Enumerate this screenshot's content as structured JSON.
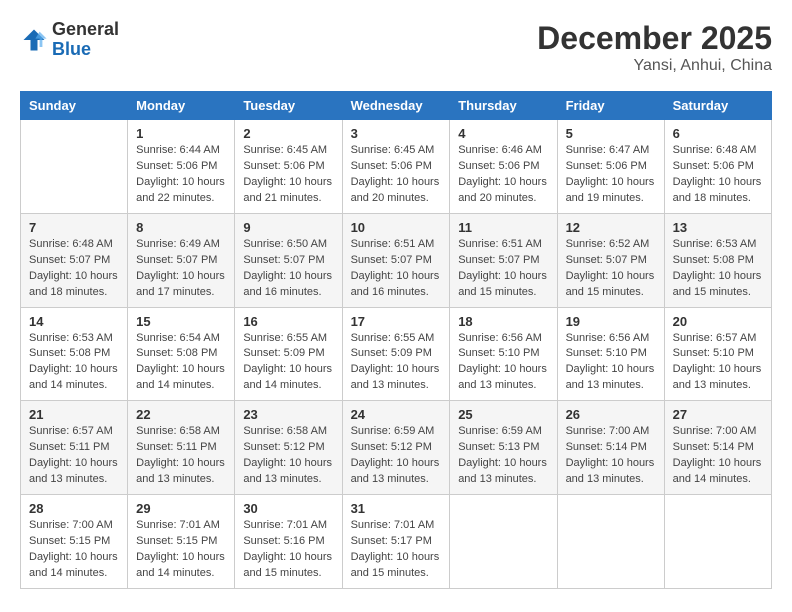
{
  "header": {
    "logo_general": "General",
    "logo_blue": "Blue",
    "month_title": "December 2025",
    "location": "Yansi, Anhui, China"
  },
  "weekdays": [
    "Sunday",
    "Monday",
    "Tuesday",
    "Wednesday",
    "Thursday",
    "Friday",
    "Saturday"
  ],
  "weeks": [
    [
      {
        "day": "",
        "info": ""
      },
      {
        "day": "1",
        "info": "Sunrise: 6:44 AM\nSunset: 5:06 PM\nDaylight: 10 hours\nand 22 minutes."
      },
      {
        "day": "2",
        "info": "Sunrise: 6:45 AM\nSunset: 5:06 PM\nDaylight: 10 hours\nand 21 minutes."
      },
      {
        "day": "3",
        "info": "Sunrise: 6:45 AM\nSunset: 5:06 PM\nDaylight: 10 hours\nand 20 minutes."
      },
      {
        "day": "4",
        "info": "Sunrise: 6:46 AM\nSunset: 5:06 PM\nDaylight: 10 hours\nand 20 minutes."
      },
      {
        "day": "5",
        "info": "Sunrise: 6:47 AM\nSunset: 5:06 PM\nDaylight: 10 hours\nand 19 minutes."
      },
      {
        "day": "6",
        "info": "Sunrise: 6:48 AM\nSunset: 5:06 PM\nDaylight: 10 hours\nand 18 minutes."
      }
    ],
    [
      {
        "day": "7",
        "info": "Sunrise: 6:48 AM\nSunset: 5:07 PM\nDaylight: 10 hours\nand 18 minutes."
      },
      {
        "day": "8",
        "info": "Sunrise: 6:49 AM\nSunset: 5:07 PM\nDaylight: 10 hours\nand 17 minutes."
      },
      {
        "day": "9",
        "info": "Sunrise: 6:50 AM\nSunset: 5:07 PM\nDaylight: 10 hours\nand 16 minutes."
      },
      {
        "day": "10",
        "info": "Sunrise: 6:51 AM\nSunset: 5:07 PM\nDaylight: 10 hours\nand 16 minutes."
      },
      {
        "day": "11",
        "info": "Sunrise: 6:51 AM\nSunset: 5:07 PM\nDaylight: 10 hours\nand 15 minutes."
      },
      {
        "day": "12",
        "info": "Sunrise: 6:52 AM\nSunset: 5:07 PM\nDaylight: 10 hours\nand 15 minutes."
      },
      {
        "day": "13",
        "info": "Sunrise: 6:53 AM\nSunset: 5:08 PM\nDaylight: 10 hours\nand 15 minutes."
      }
    ],
    [
      {
        "day": "14",
        "info": "Sunrise: 6:53 AM\nSunset: 5:08 PM\nDaylight: 10 hours\nand 14 minutes."
      },
      {
        "day": "15",
        "info": "Sunrise: 6:54 AM\nSunset: 5:08 PM\nDaylight: 10 hours\nand 14 minutes."
      },
      {
        "day": "16",
        "info": "Sunrise: 6:55 AM\nSunset: 5:09 PM\nDaylight: 10 hours\nand 14 minutes."
      },
      {
        "day": "17",
        "info": "Sunrise: 6:55 AM\nSunset: 5:09 PM\nDaylight: 10 hours\nand 13 minutes."
      },
      {
        "day": "18",
        "info": "Sunrise: 6:56 AM\nSunset: 5:10 PM\nDaylight: 10 hours\nand 13 minutes."
      },
      {
        "day": "19",
        "info": "Sunrise: 6:56 AM\nSunset: 5:10 PM\nDaylight: 10 hours\nand 13 minutes."
      },
      {
        "day": "20",
        "info": "Sunrise: 6:57 AM\nSunset: 5:10 PM\nDaylight: 10 hours\nand 13 minutes."
      }
    ],
    [
      {
        "day": "21",
        "info": "Sunrise: 6:57 AM\nSunset: 5:11 PM\nDaylight: 10 hours\nand 13 minutes."
      },
      {
        "day": "22",
        "info": "Sunrise: 6:58 AM\nSunset: 5:11 PM\nDaylight: 10 hours\nand 13 minutes."
      },
      {
        "day": "23",
        "info": "Sunrise: 6:58 AM\nSunset: 5:12 PM\nDaylight: 10 hours\nand 13 minutes."
      },
      {
        "day": "24",
        "info": "Sunrise: 6:59 AM\nSunset: 5:12 PM\nDaylight: 10 hours\nand 13 minutes."
      },
      {
        "day": "25",
        "info": "Sunrise: 6:59 AM\nSunset: 5:13 PM\nDaylight: 10 hours\nand 13 minutes."
      },
      {
        "day": "26",
        "info": "Sunrise: 7:00 AM\nSunset: 5:14 PM\nDaylight: 10 hours\nand 13 minutes."
      },
      {
        "day": "27",
        "info": "Sunrise: 7:00 AM\nSunset: 5:14 PM\nDaylight: 10 hours\nand 14 minutes."
      }
    ],
    [
      {
        "day": "28",
        "info": "Sunrise: 7:00 AM\nSunset: 5:15 PM\nDaylight: 10 hours\nand 14 minutes."
      },
      {
        "day": "29",
        "info": "Sunrise: 7:01 AM\nSunset: 5:15 PM\nDaylight: 10 hours\nand 14 minutes."
      },
      {
        "day": "30",
        "info": "Sunrise: 7:01 AM\nSunset: 5:16 PM\nDaylight: 10 hours\nand 15 minutes."
      },
      {
        "day": "31",
        "info": "Sunrise: 7:01 AM\nSunset: 5:17 PM\nDaylight: 10 hours\nand 15 minutes."
      },
      {
        "day": "",
        "info": ""
      },
      {
        "day": "",
        "info": ""
      },
      {
        "day": "",
        "info": ""
      }
    ]
  ]
}
